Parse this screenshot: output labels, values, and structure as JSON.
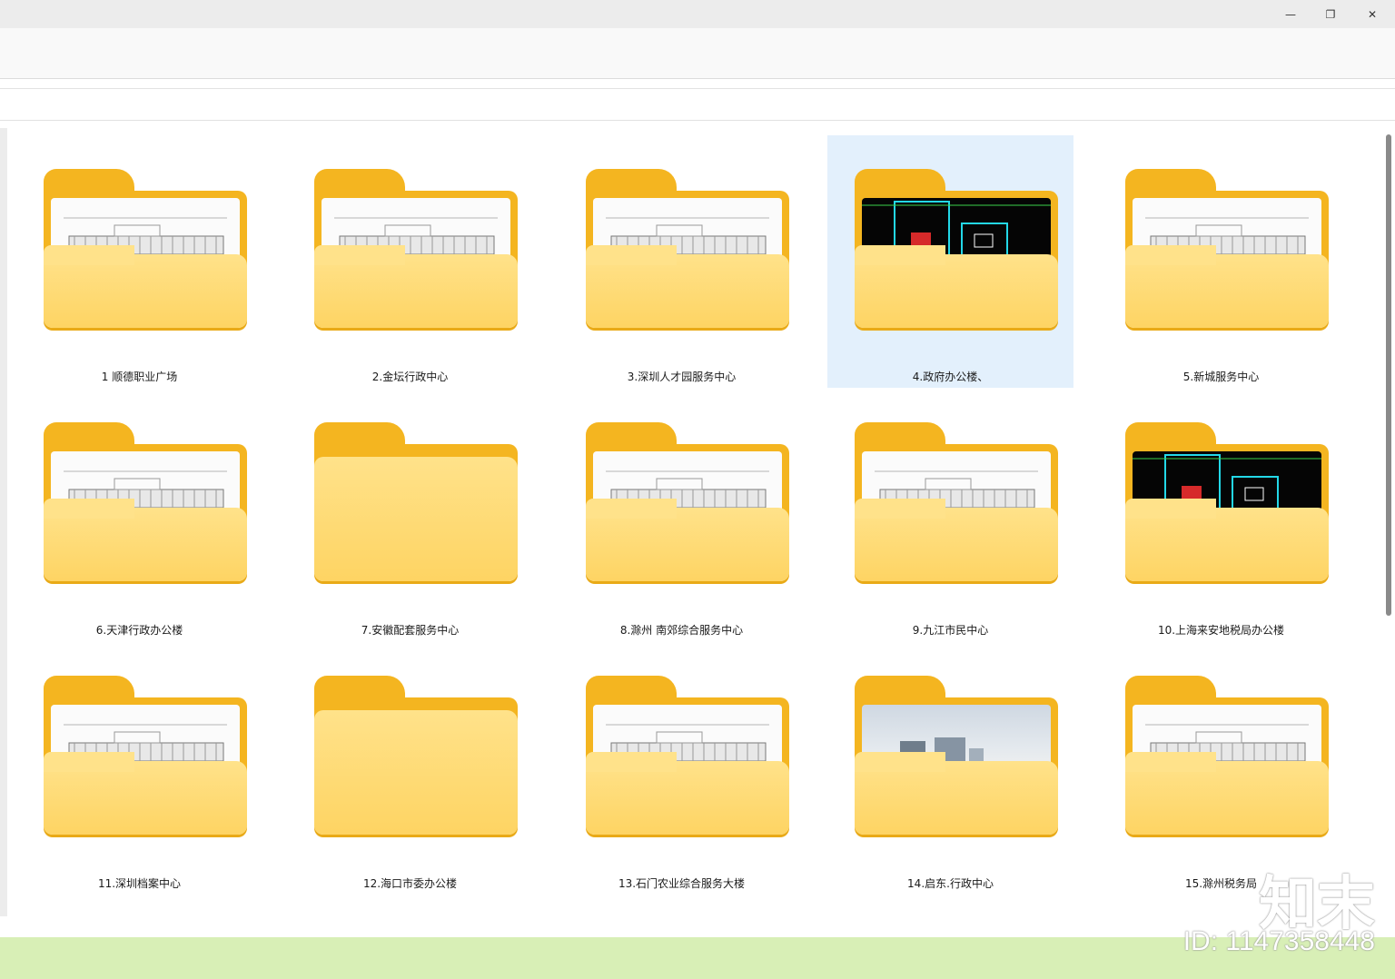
{
  "window": {
    "controls": [
      "—",
      "❐",
      "✕"
    ]
  },
  "folders": [
    {
      "label": "1 顺德职业广场",
      "preview": "drawing"
    },
    {
      "label": "2.金坛行政中心",
      "preview": "drawing"
    },
    {
      "label": "3.深圳人才园服务中心",
      "preview": "drawing"
    },
    {
      "label": "4.政府办公楼、",
      "preview": "dark"
    },
    {
      "label": "5.新城服务中心",
      "preview": "drawing"
    },
    {
      "label": "6.天津行政办公楼",
      "preview": "drawing"
    },
    {
      "label": "7.安徽配套服务中心",
      "preview": "empty"
    },
    {
      "label": "8.滁州 南郊综合服务中心",
      "preview": "drawing"
    },
    {
      "label": "9.九江市民中心",
      "preview": "drawing"
    },
    {
      "label": "10.上海来安地税局办公楼",
      "preview": "dark"
    },
    {
      "label": "11.深圳档案中心",
      "preview": "drawing"
    },
    {
      "label": "12.海口市委办公楼",
      "preview": "empty"
    },
    {
      "label": "13.石门农业综合服务大楼",
      "preview": "drawing"
    },
    {
      "label": "14.启东.行政中心",
      "preview": "photo"
    },
    {
      "label": "15.滁州税务局",
      "preview": "drawing"
    }
  ],
  "selected_index": 3,
  "watermark": {
    "logo": "知末",
    "id": "ID: 1147358448"
  },
  "colors": {
    "folder": "#f4b520",
    "folder_front": "#fed463",
    "selection": "#e3f0fc",
    "footer": "#d8efb6"
  }
}
